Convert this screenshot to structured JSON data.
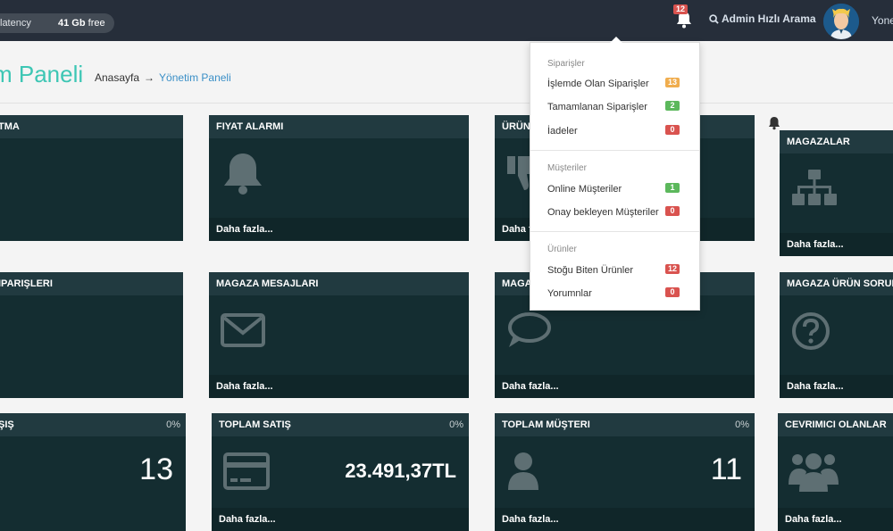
{
  "topbar": {
    "latency_label": "latency",
    "free_value": "41 Gb",
    "free_label": "free",
    "notif_count": "12",
    "search_label": "Admin Hızlı Arama",
    "user_name": "Yone"
  },
  "header": {
    "title": "m Paneli",
    "breadcrumb_home": "Anasayfa",
    "breadcrumb_arrow": "→",
    "breadcrumb_current": "Yönetim Paneli"
  },
  "cards": {
    "c1": {
      "title": "TMA"
    },
    "c2": {
      "title": "FIYAT ALARMI",
      "footer": "Daha fazla..."
    },
    "c3": {
      "title": "ÜRÜN",
      "footer": "Daha f"
    },
    "c4": {
      "title": "MAGAZALAR",
      "footer": "Daha fazla..."
    },
    "c5": {
      "title": "IPARIŞLERI"
    },
    "c6": {
      "title": "MAGAZA MESAJLARI",
      "footer": "Daha fazla..."
    },
    "c7": {
      "title": "MAGA",
      "footer": "Daha fazla..."
    },
    "c8": {
      "title": "MAGAZA ÜRÜN SORULA",
      "footer": "Daha fazla..."
    },
    "c9": {
      "title": "ŞIŞ",
      "percent": "0%",
      "value": "13"
    },
    "c10": {
      "title": "TOPLAM SATIŞ",
      "percent": "0%",
      "value": "23.491,37TL",
      "footer": "Daha fazla..."
    },
    "c11": {
      "title": "TOPLAM MÜŞTERI",
      "percent": "0%",
      "value": "11",
      "footer": "Daha fazla..."
    },
    "c12": {
      "title": "CEVRIMICI OLANLAR",
      "footer": "Daha fazla..."
    }
  },
  "dropdown": {
    "sec_orders": "Siparişler",
    "orders_processing": "İşlemde Olan Siparişler",
    "orders_processing_count": "13",
    "orders_done": "Tamamlanan Siparişler",
    "orders_done_count": "2",
    "returns": "İadeler",
    "returns_count": "0",
    "sec_customers": "Müşteriler",
    "online": "Online Müşteriler",
    "online_count": "1",
    "pending": "Onay bekleyen Müşteriler",
    "pending_count": "0",
    "sec_products": "Ürünler",
    "out_of_stock": "Stoğu Biten Ürünler",
    "out_of_stock_count": "12",
    "comments": "Yorumnlar",
    "comments_count": "0"
  },
  "colors": {
    "accent": "#3dc6b4",
    "card_bg": "#142d31",
    "badge_orange": "#f0ad4e",
    "badge_green": "#5cb85c",
    "badge_red": "#d9534f"
  }
}
